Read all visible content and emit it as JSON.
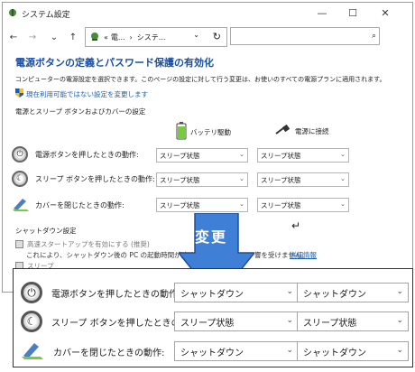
{
  "window": {
    "title": "システム設定",
    "controls": {
      "minimize": "—",
      "maximize": "☐",
      "close": "✕"
    }
  },
  "addressbar": {
    "back": "←",
    "forward": "→",
    "up": "↑",
    "path_sep1": "«",
    "path_item1": "電...",
    "path_sep2": "›",
    "path_item2": "システ...",
    "dropdown": "⌄",
    "refresh": "↻",
    "search_icon": "⌕"
  },
  "content": {
    "title": "電源ボタンの定義とパスワード保護の有効化",
    "description": "コンピューターの電源設定を選択できます。このページの設定に対して行う変更は、お使いのすべての電源プランに適用されます。",
    "unavailable_link": "現在利用可能ではない設定を変更します",
    "section_power": "電源とスリープ ボタンおよびカバーの設定",
    "col_battery": "バッテリ駆動",
    "col_plugged": "電源に接続",
    "rows": [
      {
        "label": "電源ボタンを押したときの動作:",
        "battery": "スリープ状態",
        "plugged": "スリープ状態"
      },
      {
        "label": "スリープ ボタンを押したときの動作:",
        "battery": "スリープ状態",
        "plugged": "スリープ状態"
      },
      {
        "label": "カバーを閉じたときの動作:",
        "battery": "スリープ状態",
        "plugged": "スリープ状態"
      }
    ],
    "section_shutdown": "シャットダウン設定",
    "fast_startup": "高速スタートアップを有効にする (推奨)",
    "fast_startup_desc": "これにより、シャットダウン後の PC の起動時間が速く",
    "fast_startup_desc2": "響を受けません。",
    "detail_link": "詳細情報",
    "sleep_cb": "スリープ"
  },
  "annotation": {
    "change_label": "変更"
  },
  "zoomed": {
    "rows": [
      {
        "label": "電源ボタンを押したときの動作:",
        "battery": "シャットダウン",
        "plugged": "シャットダウン"
      },
      {
        "label": "スリープ ボタンを押したときの動作:",
        "battery": "スリープ状態",
        "plugged": "スリープ状態"
      },
      {
        "label": "カバーを閉じたときの動作:",
        "battery": "シャットダウン",
        "plugged": "シャットダウン"
      }
    ]
  },
  "colors": {
    "title_blue": "#1a4fa3",
    "link_blue": "#1a5fb4",
    "arrow_blue": "#3f7fd6"
  },
  "icons": [
    "settings-app-icon",
    "power-icon",
    "battery-icon",
    "plug-icon",
    "laptop-cover-icon",
    "shield-icon",
    "return-icon"
  ]
}
